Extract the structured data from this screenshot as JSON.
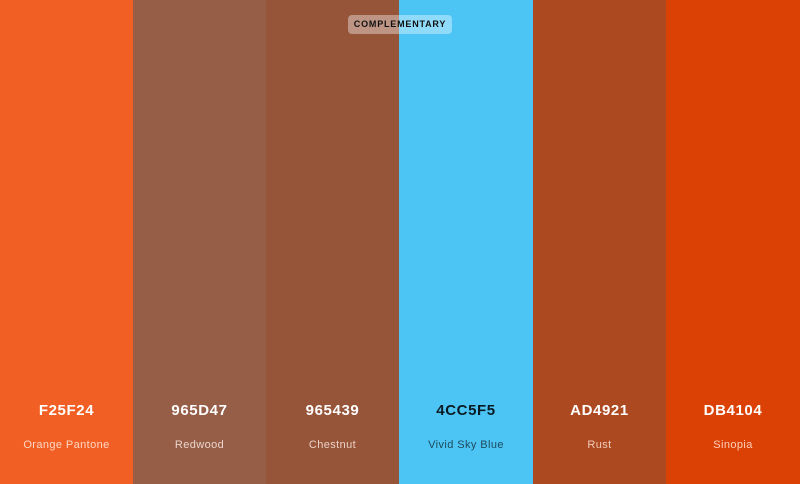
{
  "palette": {
    "scheme_label": "COMPLEMENTARY",
    "swatches": [
      {
        "hex": "F25F24",
        "name": "Orange Pantone",
        "color": "#F25F24",
        "hex_color": "#FFFFFF",
        "name_color": "#FFD8C4"
      },
      {
        "hex": "965D47",
        "name": "Redwood",
        "color": "#965D47",
        "hex_color": "#FFFFFF",
        "name_color": "#EBD6CC"
      },
      {
        "hex": "965439",
        "name": "Chestnut",
        "color": "#965439",
        "hex_color": "#FFFFFF",
        "name_color": "#EBD2C6"
      },
      {
        "hex": "4CC5F5",
        "name": "Vivid Sky Blue",
        "color": "#4CC5F5",
        "hex_color": "#0A1A22",
        "name_color": "#1F4A5C"
      },
      {
        "hex": "AD4921",
        "name": "Rust",
        "color": "#AD4921",
        "hex_color": "#FFFFFF",
        "name_color": "#F1CCBB"
      },
      {
        "hex": "DB4104",
        "name": "Sinopia",
        "color": "#DB4104",
        "hex_color": "#FFFFFF",
        "name_color": "#FFD0BC"
      }
    ]
  }
}
